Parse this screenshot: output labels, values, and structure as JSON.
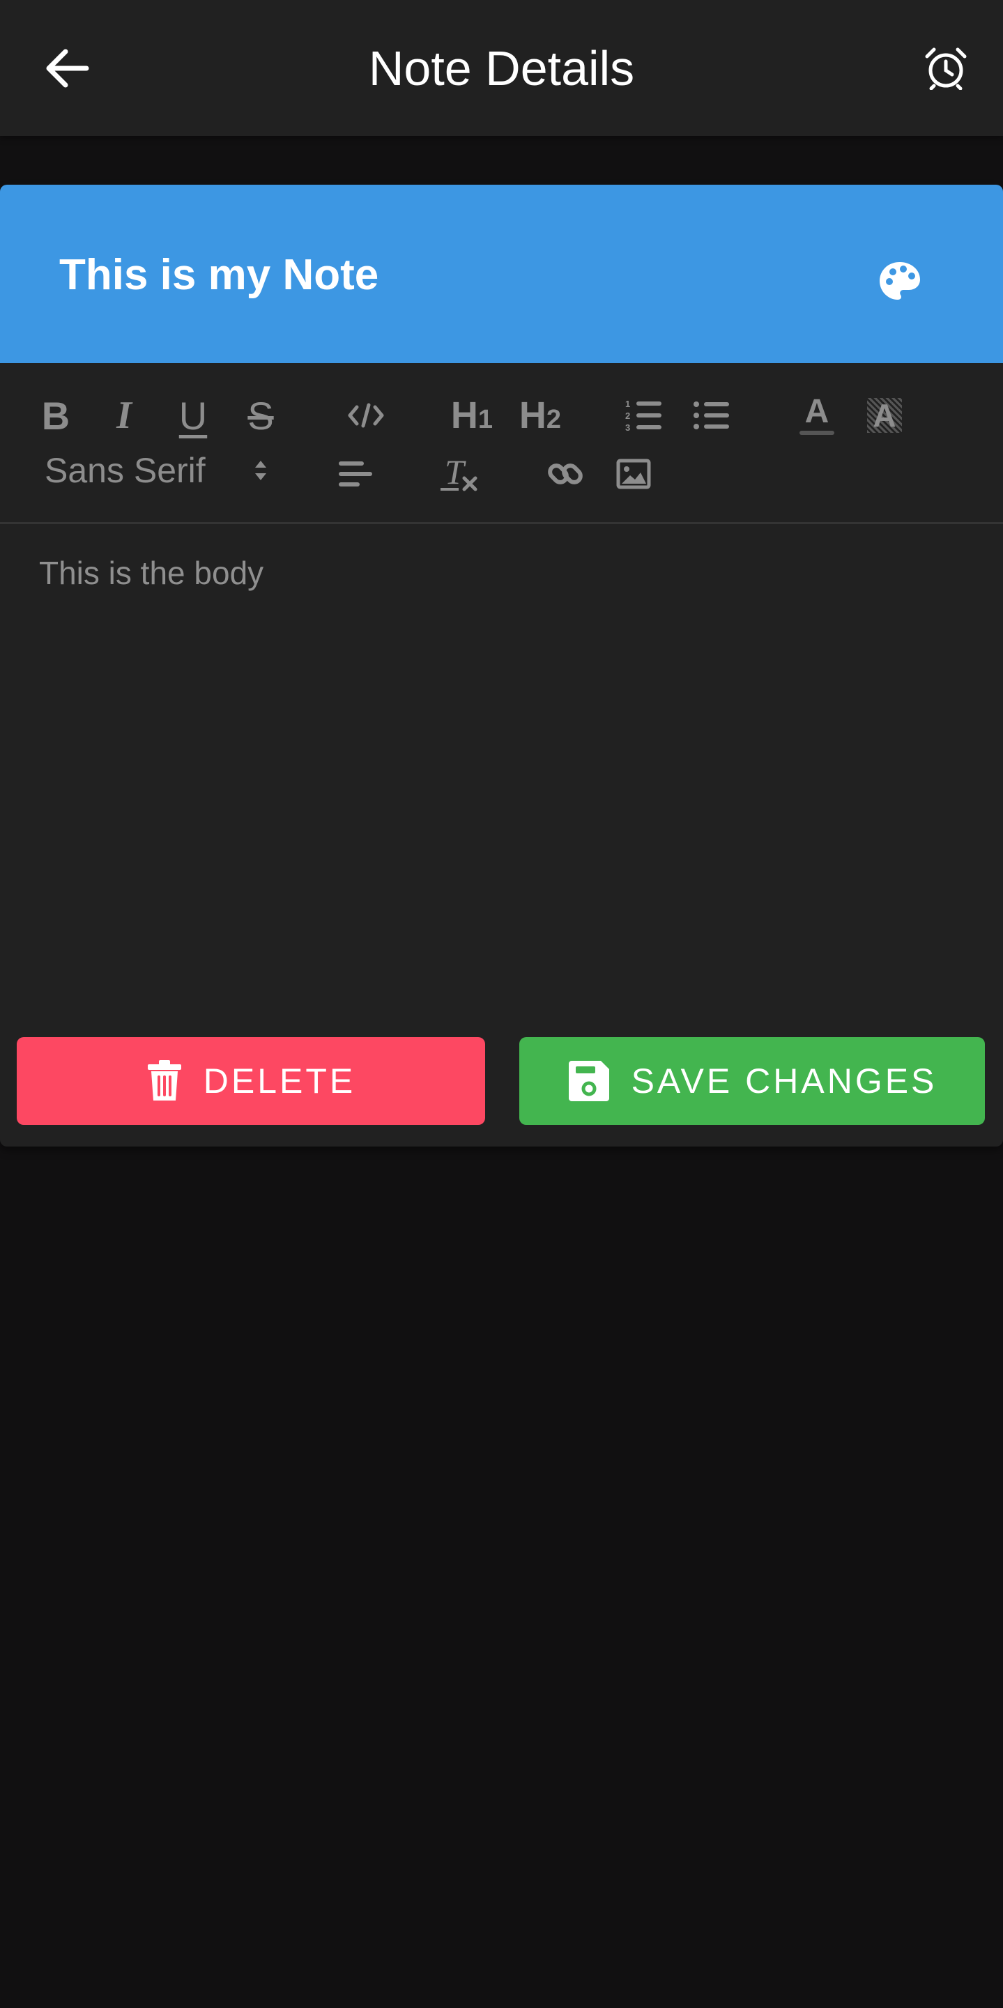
{
  "app_bar": {
    "title": "Note Details",
    "back_icon": "arrow-left-icon",
    "alarm_icon": "alarm-clock-icon"
  },
  "note": {
    "title": "This is my Note",
    "header_color": "#3d97e3",
    "palette_icon": "palette-icon",
    "body": "This is the body"
  },
  "toolbar": {
    "bold": "B",
    "italic": "I",
    "underline": "U",
    "strike": "S",
    "h1": "H",
    "h1_sub": "1",
    "h2": "H",
    "h2_sub": "2",
    "font_family": "Sans Serif",
    "color_letter": "A",
    "background_letter": "A",
    "clean_letter": "T",
    "icons": [
      "bold-icon",
      "italic-icon",
      "underline-icon",
      "strikethrough-icon",
      "code-block-icon",
      "heading-1-icon",
      "heading-2-icon",
      "ordered-list-icon",
      "bullet-list-icon",
      "text-color-icon",
      "background-color-icon",
      "font-family-select",
      "align-left-icon",
      "clear-formatting-icon",
      "link-icon",
      "image-icon"
    ]
  },
  "actions": {
    "delete_label": "DELETE",
    "delete_color": "#fd4862",
    "delete_icon": "trash-icon",
    "save_label": "SAVE CHANGES",
    "save_color": "#43b54f",
    "save_icon": "floppy-disk-icon"
  },
  "colors": {
    "background": "#111011",
    "surface": "#212121",
    "toolbar_icon": "#8d8d8d"
  }
}
